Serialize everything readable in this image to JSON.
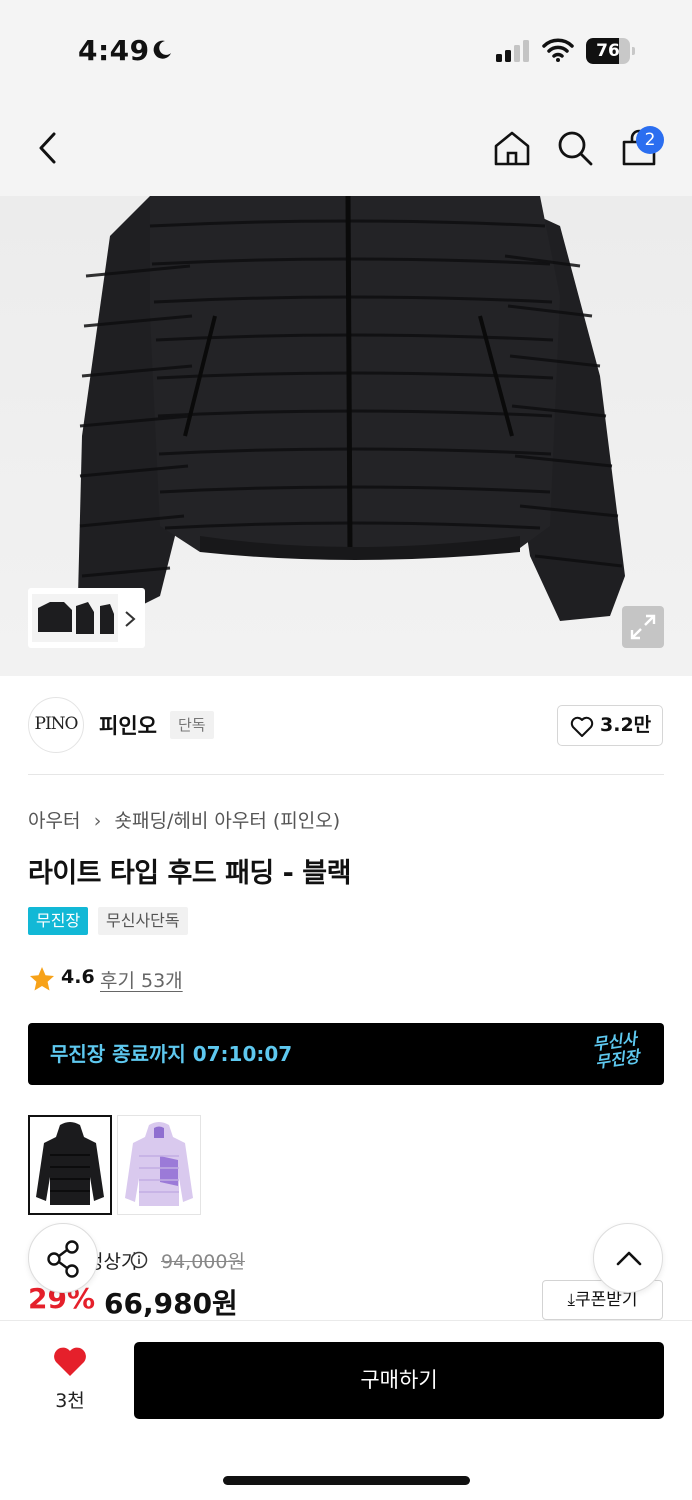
{
  "status_bar": {
    "time": "4:49",
    "battery": "76",
    "battery_level": 0.76
  },
  "nav": {
    "cart_count": "2"
  },
  "brand": {
    "logo_text": "PINO",
    "name": "피인오",
    "badge": "단독",
    "likes": "3.2만"
  },
  "product": {
    "breadcrumb": [
      "아우터",
      "숏패딩/헤비 아우터 (피인오)"
    ],
    "title": "라이트 타입 후드 패딩 - 블랙",
    "tags": [
      "무진장",
      "무신사단독"
    ],
    "rating": "4.6",
    "reviews": "후기 53개"
  },
  "countdown": {
    "text": "무진장 종료까지 07:10:07",
    "logo_line1": "무신사",
    "logo_line2": "무진장"
  },
  "colors": {
    "swatches": [
      {
        "name": "black",
        "hex": "#1b1b1d",
        "selected": true
      },
      {
        "name": "lavender",
        "hex": "#d9c9ee",
        "selected": false
      }
    ]
  },
  "price": {
    "label": "정상가",
    "original": "94,000원",
    "discount": "29%",
    "sale": "66,980원",
    "coupon_label": "쿠폰받기"
  },
  "bottom": {
    "wish_count": "3천",
    "buy_label": "구매하기"
  },
  "theme": {
    "accent": "#12b8d6",
    "discount_red": "#e5202b",
    "badge_blue": "#2b6ef0",
    "countdown_text": "#5ec8ef"
  }
}
